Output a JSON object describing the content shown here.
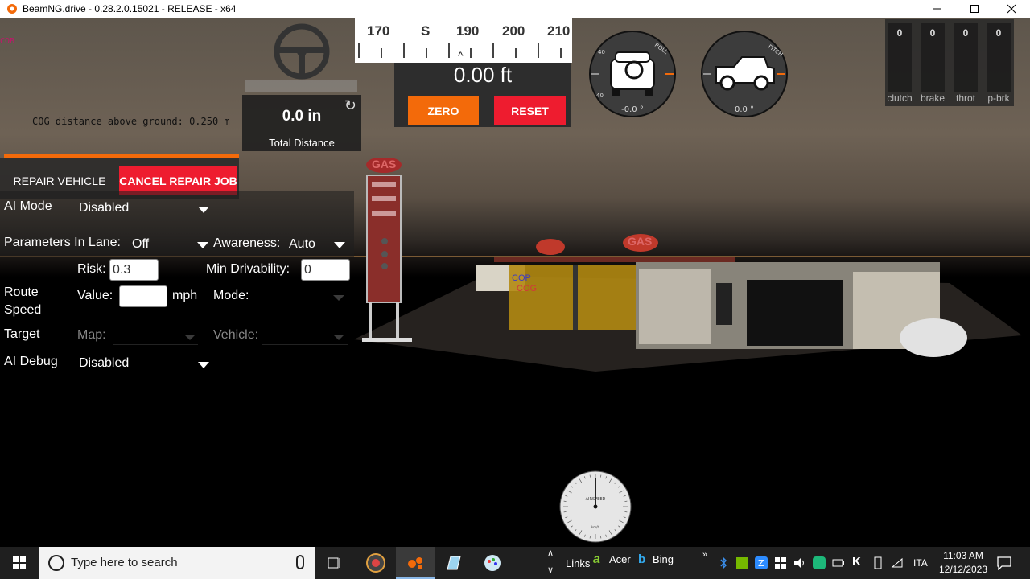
{
  "window": {
    "title": "BeamNG.drive - 0.28.2.0.15021 - RELEASE - x64",
    "min_icon": "minimize-icon",
    "max_icon": "maximize-icon",
    "close_icon": "close-icon"
  },
  "scene": {
    "cob_label": "COB",
    "cog_text": "COG distance above ground: 0.250 m",
    "sign_labels": [
      "GAS",
      "GAS"
    ],
    "store_labels": [
      "COP",
      "COG"
    ]
  },
  "distance": {
    "value": "0.0 in",
    "label": "Total Distance"
  },
  "compass": {
    "labels": [
      "170",
      "S",
      "190",
      "200",
      "210"
    ],
    "pointer": "^",
    "altitude": "0.00 ft",
    "zero_label": "ZERO",
    "reset_label": "RESET"
  },
  "gauges": {
    "roll": {
      "value": "-0.0 °",
      "title": "ROLL"
    },
    "pitch": {
      "value": "0.0 °",
      "title": "PITCH"
    }
  },
  "pedals": [
    {
      "label": "clutch",
      "value": "0"
    },
    {
      "label": "brake",
      "value": "0"
    },
    {
      "label": "throt",
      "value": "0"
    },
    {
      "label": "p-brk",
      "value": "0"
    }
  ],
  "repair": {
    "repair_label": "REPAIR VEHICLE",
    "cancel_label": "CANCEL REPAIR JOB"
  },
  "ai": {
    "mode_label": "AI Mode",
    "mode_value": "Disabled",
    "params_label": "Parameters In Lane:",
    "params_value": "Off",
    "awareness_label": "Awareness:",
    "awareness_value": "Auto",
    "risk_label": "Risk:",
    "risk_value": "0.3",
    "min_driv_label": "Min Drivability:",
    "min_driv_value": "0",
    "route_label": "Route",
    "speed_label": "Speed",
    "value_label": "Value:",
    "speed_value": "",
    "unit_label": "mph",
    "route_mode_label": "Mode:",
    "target_label": "Target",
    "map_label": "Map:",
    "vehicle_label": "Vehicle:",
    "debug_label": "AI Debug",
    "debug_value": "Disabled"
  },
  "airspeed": {
    "label": "AIRSPEED",
    "unit": "km/h",
    "needle_value": 0
  },
  "taskbar": {
    "search_placeholder": "Type here to search",
    "links_label": "Links",
    "acer_label": "Acer",
    "bing_label": "Bing",
    "language": "ITA",
    "time": "11:03 AM",
    "date": "12/12/2023"
  },
  "colors": {
    "orange": "#f36a0a",
    "red": "#ee1c2f",
    "panel": "#2d2d2d"
  }
}
